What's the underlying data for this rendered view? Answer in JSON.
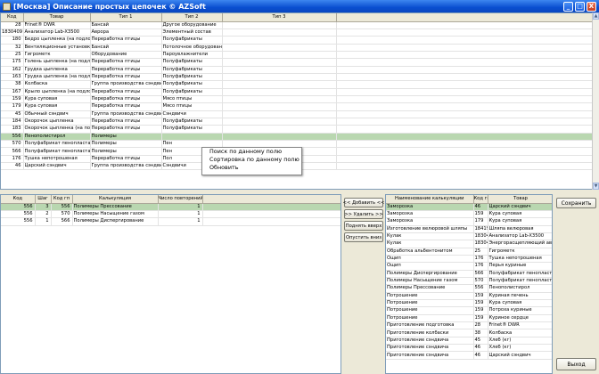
{
  "window": {
    "title": "[Москва] Описание простых цепочек   © AZSoft",
    "buttons": [
      "_",
      "□",
      "X"
    ]
  },
  "main_grid": {
    "columns": [
      "Код",
      "Товар",
      "Тип 1",
      "Тип 2",
      "Тип 3"
    ],
    "rows": [
      [
        "28",
        "Frinet® DWR",
        "Бансай",
        "Другое оборудование",
        ""
      ],
      [
        "1830409",
        "Анализатор Lab-X3500",
        "Аврора",
        "Элементный состав",
        ""
      ],
      [
        "180",
        "Бедро цыпленка (на подлож",
        "Переработка птицы",
        "Полуфабрикаты",
        ""
      ],
      [
        "32",
        "Вентиляционные установки",
        "Бансай",
        "Потолочное оборудование",
        ""
      ],
      [
        "25",
        "Гигрометк",
        "Оборудование",
        "Пароувлажнители",
        ""
      ],
      [
        "175",
        "Голень цыпленка (на подлож",
        "Переработка птицы",
        "Полуфабрикаты",
        ""
      ],
      [
        "162",
        "Грудка цыпленка",
        "Переработка птицы",
        "Полуфабрикаты",
        ""
      ],
      [
        "163",
        "Грудка цыпленка (на подлож",
        "Переработка птицы",
        "Полуфабрикаты",
        ""
      ],
      [
        "38",
        "Колбаска",
        "Группа производства сэндвичей",
        "Полуфабрикаты",
        ""
      ],
      [
        "167",
        "Крыло цыпленка (на подлож",
        "Переработка птицы",
        "Полуфабрикаты",
        ""
      ],
      [
        "159",
        "Кура суповая",
        "Переработка птицы",
        "Мясо птицы",
        ""
      ],
      [
        "179",
        "Кура суповая",
        "Переработка птицы",
        "Мясо птицы",
        ""
      ],
      [
        "45",
        "Обычный сэндвич",
        "Группа производства сэндвичей",
        "Сэндвичи",
        ""
      ],
      [
        "184",
        "Окорочок цыпленка",
        "Переработка птицы",
        "Полуфабрикаты",
        ""
      ],
      [
        "183",
        "Окорочок цыпленка (на под",
        "Переработка птицы",
        "Полуфабрикаты",
        ""
      ],
      [
        "556",
        "Пенополистирол",
        "Полимеры",
        "",
        ""
      ],
      [
        "570",
        "Полуфабрикат пенопласта в",
        "Полимеры",
        "Пен",
        ""
      ],
      [
        "566",
        "Полуфабрикат пенопласта ф",
        "Полимеры",
        "Пен",
        ""
      ],
      [
        "176",
        "Тушка непотрошеная",
        "Переработка птицы",
        "Пол",
        ""
      ],
      [
        "46",
        "Царский сэндвич",
        "Группа производства сэндвичей",
        "Сэндвичи",
        ""
      ]
    ],
    "mid_marks": {
      "10": "З",
      "11": "О"
    }
  },
  "context_menu": {
    "items": [
      "Поиск по данному полю",
      "Сортировка по данному полю",
      "Обновить"
    ]
  },
  "bottom_grid": {
    "columns": [
      "Код",
      "Шаг",
      "Код гп",
      "Калькуляция",
      "Число повторений"
    ],
    "rows": [
      [
        "556",
        "3",
        "556",
        "Полимеры Прессование",
        "1"
      ],
      [
        "556",
        "2",
        "570",
        "Полимеры Насыщение газом",
        "1"
      ],
      [
        "556",
        "1",
        "566",
        "Полимеры Диспергирование",
        "1"
      ]
    ]
  },
  "middle_buttons": {
    "add": "<< Добавить <<",
    "remove": ">> Удалить >>",
    "up": "Поднять вверх",
    "down": "Опустить вниз"
  },
  "right_grid": {
    "columns": [
      "Наименование калькуляции",
      "Код гп",
      "Товар"
    ],
    "rows": [
      [
        "Заморозка",
        "46",
        "Царский сэндвич"
      ],
      [
        "Заморозка",
        "159",
        "Кура суповая"
      ],
      [
        "Заморозка",
        "179",
        "Кура суповая"
      ],
      [
        "Изготовление велюровой шляпы",
        "18419",
        "Шляпа велюровая"
      ],
      [
        "Кулак",
        "183049",
        "Анализатор Lab-X3500"
      ],
      [
        "Кулак",
        "183049",
        "Энергорасщепляющий ави"
      ],
      [
        "Обработка альбентонитом",
        "25",
        "Гигрометк"
      ],
      [
        "Ощип",
        "176",
        "Тушка непотрошеная"
      ],
      [
        "Ощип",
        "176",
        "Перья куриные"
      ],
      [
        "Полимеры Диспергирование",
        "566",
        "Полуфабрикат пенопласт"
      ],
      [
        "Полимеры Насыщение газом",
        "570",
        "Полуфабрикат пенопласт"
      ],
      [
        "Полимеры Прессование",
        "556",
        "Пенополистирол"
      ],
      [
        "Потрошение",
        "159",
        "Куриная печень"
      ],
      [
        "Потрошение",
        "159",
        "Кура суповая"
      ],
      [
        "Потрошение",
        "159",
        "Потроха куриные"
      ],
      [
        "Потрошение",
        "159",
        "Куриное сердце"
      ],
      [
        "Приготовление подготовка",
        "28",
        "Frinet® DWR"
      ],
      [
        "Приготовление колбаски",
        "38",
        "Колбаска"
      ],
      [
        "Приготовление сэндвича",
        "45",
        "Хлеб (кг)"
      ],
      [
        "Приготовление сэндвича",
        "46",
        "Хлеб (кг)"
      ],
      [
        "Приготовление сэндвича",
        "46",
        "Царский сэндвич"
      ]
    ]
  },
  "right_buttons": {
    "save": "Сохранить",
    "exit": "Выход"
  }
}
